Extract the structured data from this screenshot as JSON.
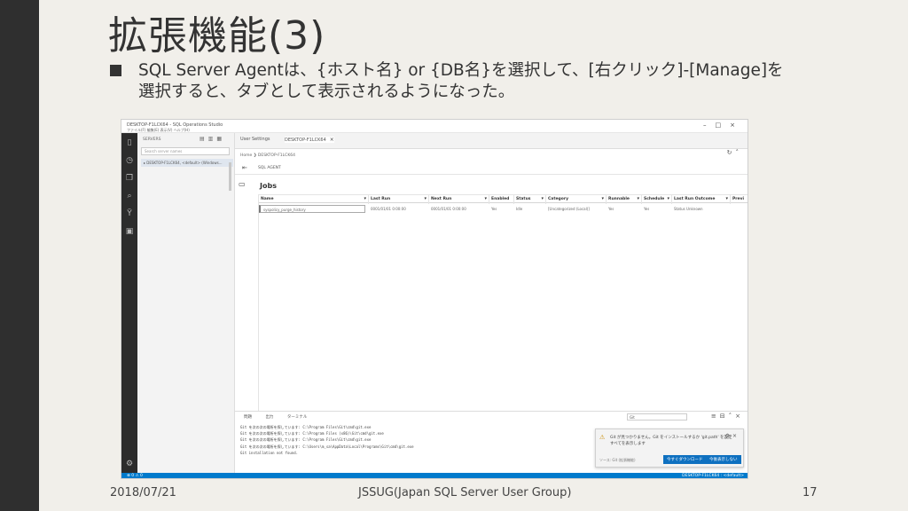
{
  "slide": {
    "title": "拡張機能(3)",
    "bullet_line1": "SQL Server Agentは、{ホスト名}  or {DB名}を選択して、[右クリック]-[Manage]を",
    "bullet_line2": "選択すると、タブとして表示されるようになった。",
    "footer_date": "2018/07/21",
    "footer_org": "JSSUG(Japan SQL Server User Group)",
    "footer_page": "17"
  },
  "app": {
    "window_title": "DESKTOP-F1LCK64 - SQL Operations Studio",
    "menu": "ファイル(F)   編集(E)   表示(V)   ヘルプ(H)",
    "sidebar_header": "SERVERS",
    "search_placeholder": "Search server names",
    "server_node": "▸ DESKTOP-F1LCK64, <default> (Windows...",
    "tabs": [
      {
        "label": "User Settings"
      },
      {
        "label": "DESKTOP-F1LCK64"
      }
    ],
    "breadcrumb": "Home  ❯  DESKTOP-F1LCK64",
    "subtab_label": "SQL AGENT",
    "jobs_title": "Jobs",
    "columns": [
      "Name",
      "Last Run",
      "Next Run",
      "Enabled",
      "Status",
      "Category",
      "Runnable",
      "Schedule",
      "Last Run Outcome",
      "Previ"
    ],
    "row": {
      "name": "syspolicy_purge_history",
      "last_run": "0001/01/01 0:00:00",
      "next_run": "0001/01/01 0:00:00",
      "enabled": "Yes",
      "status": "Idle",
      "category": "[Uncategorized (Local)]",
      "runnable": "Yes",
      "schedule": "Yes",
      "outcome": "Status Unknown"
    },
    "panel_tabs": [
      "問題",
      "出力",
      "ターミナル"
    ],
    "panel_filter": "Git",
    "log_lines": [
      "Git を次の次の場所を探しています: C:\\Program Files\\Git\\cmd\\git.exe",
      "Git を次の次の場所を探しています: C:\\Program Files (x86)\\Git\\cmd\\git.exe",
      "Git を次の次の場所を探しています: C:\\Program Files\\Git\\cmd\\git.exe",
      "Git を次の次の場所を探しています: C:\\Users\\m_sa\\AppData\\Local\\Programs\\Git\\cmd\\git.exe",
      "Git installation not found."
    ],
    "notification": {
      "line1": "Git が見つかりません。Git をインストールするか 'git.path' を設定",
      "line2": "すべてを表示します",
      "source": "ソース: Git (拡張機能)",
      "btn_download": "今すぐダウンロード",
      "btn_dismiss": "今後表示しない"
    },
    "status_right": "DESKTOP-F1LCK64 : <default>"
  }
}
